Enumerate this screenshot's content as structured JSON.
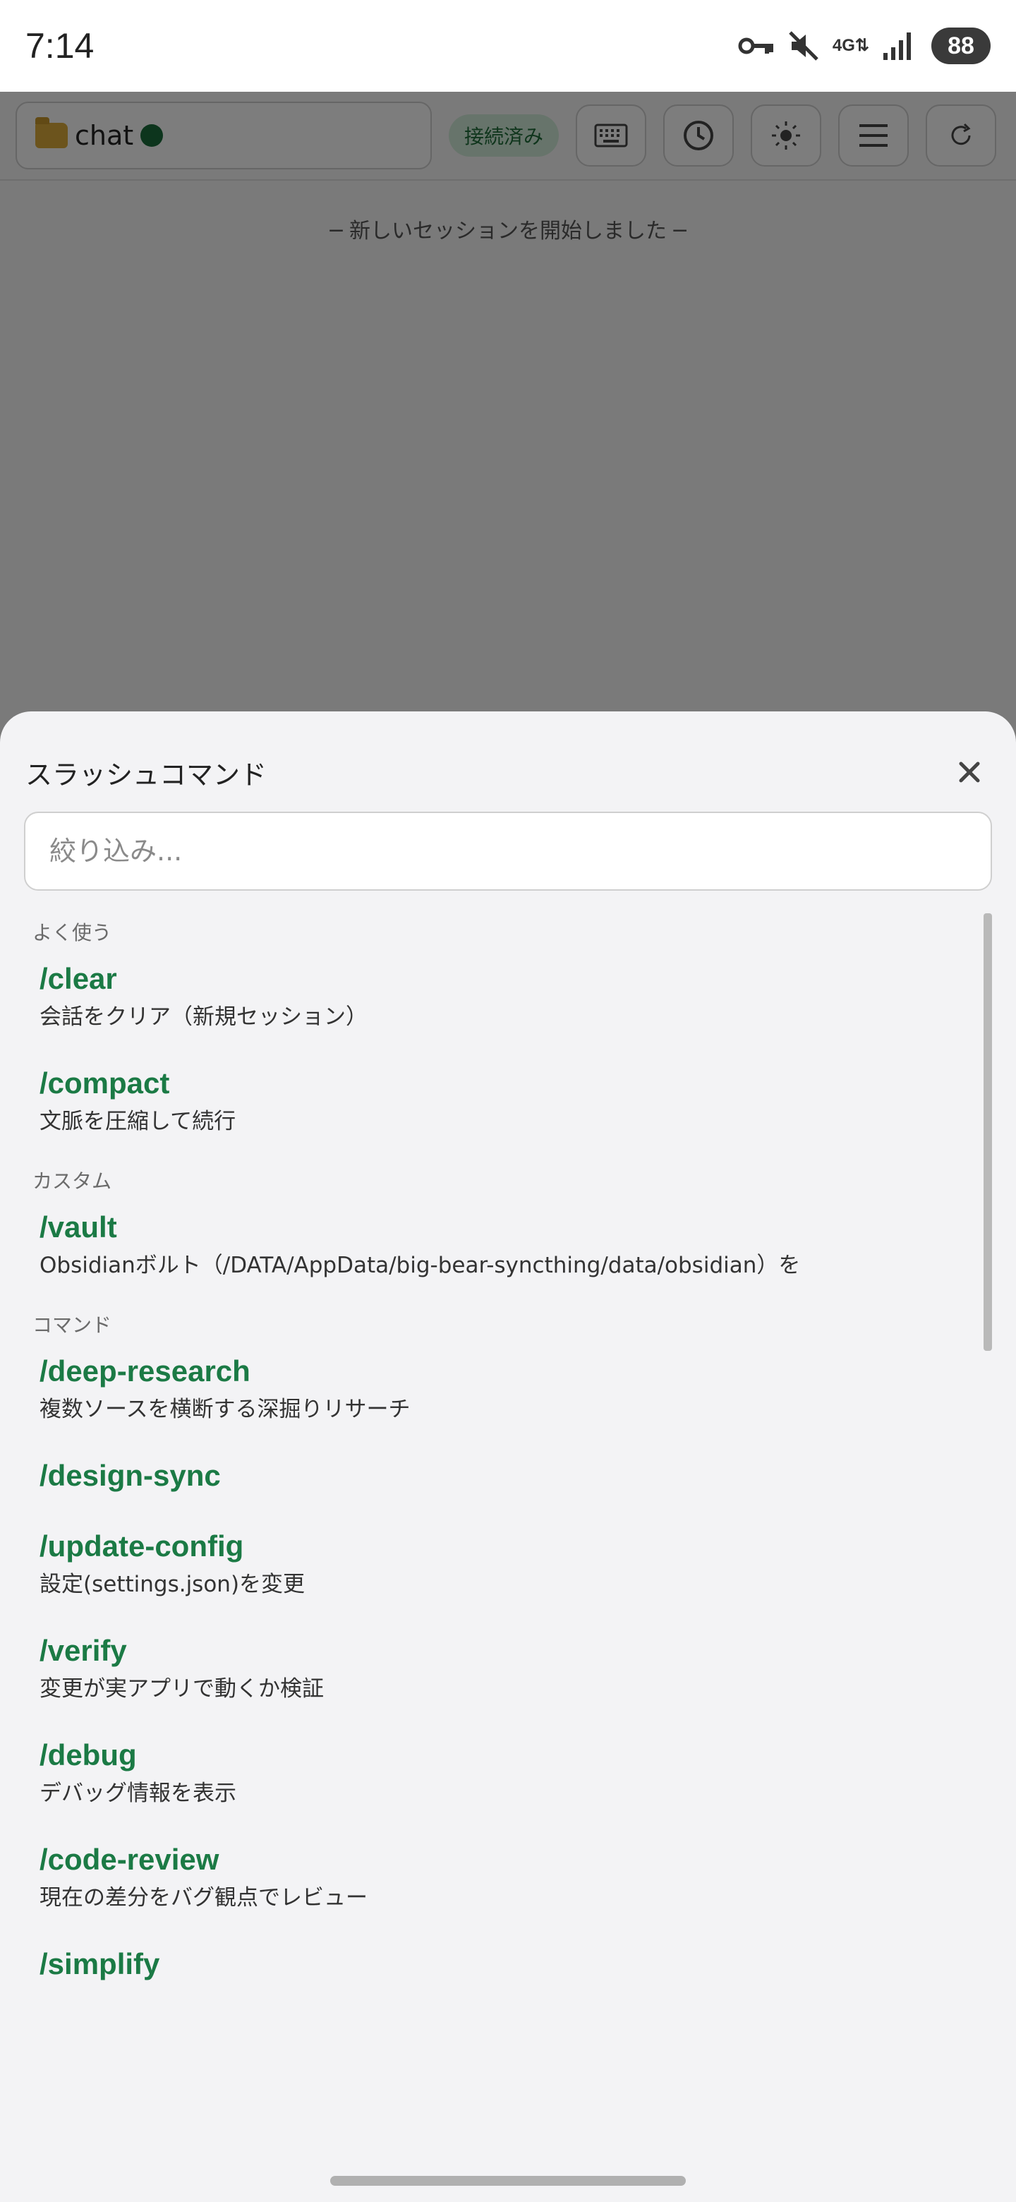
{
  "status_bar": {
    "time": "7:14",
    "icons": [
      "vpn-key-icon",
      "mute-icon",
      "network-4g-icon",
      "signal-icon"
    ],
    "network_label": "4G",
    "battery": "88"
  },
  "app": {
    "chat_name": "chat",
    "connection_status": "接続済み",
    "toolbar_icons": [
      "keyboard-icon",
      "history-icon",
      "theme-icon",
      "menu-icon",
      "refresh-icon"
    ],
    "session_message": "─ 新しいセッションを開始しました ─"
  },
  "sheet": {
    "title": "スラッシュコマンド",
    "filter_placeholder": "絞り込み...",
    "sections": [
      {
        "label": "よく使う",
        "commands": [
          {
            "name": "/clear",
            "desc": "会話をクリア（新規セッション）"
          },
          {
            "name": "/compact",
            "desc": "文脈を圧縮して続行"
          }
        ]
      },
      {
        "label": "カスタム",
        "commands": [
          {
            "name": "/vault",
            "desc": "Obsidianボルト（/DATA/AppData/big-bear-syncthing/data/obsidian）を"
          }
        ]
      },
      {
        "label": "コマンド",
        "commands": [
          {
            "name": "/deep-research",
            "desc": "複数ソースを横断する深掘りリサーチ"
          },
          {
            "name": "/design-sync",
            "desc": ""
          },
          {
            "name": "/update-config",
            "desc": "設定(settings.json)を変更"
          },
          {
            "name": "/verify",
            "desc": "変更が実アプリで動くか検証"
          },
          {
            "name": "/debug",
            "desc": "デバッグ情報を表示"
          },
          {
            "name": "/code-review",
            "desc": "現在の差分をバグ観点でレビュー"
          },
          {
            "name": "/simplify",
            "desc": ""
          }
        ]
      }
    ]
  },
  "colors": {
    "accent": "#1b7a45",
    "badge_bg": "#cfe9d6",
    "online": "#1a6b3a"
  }
}
